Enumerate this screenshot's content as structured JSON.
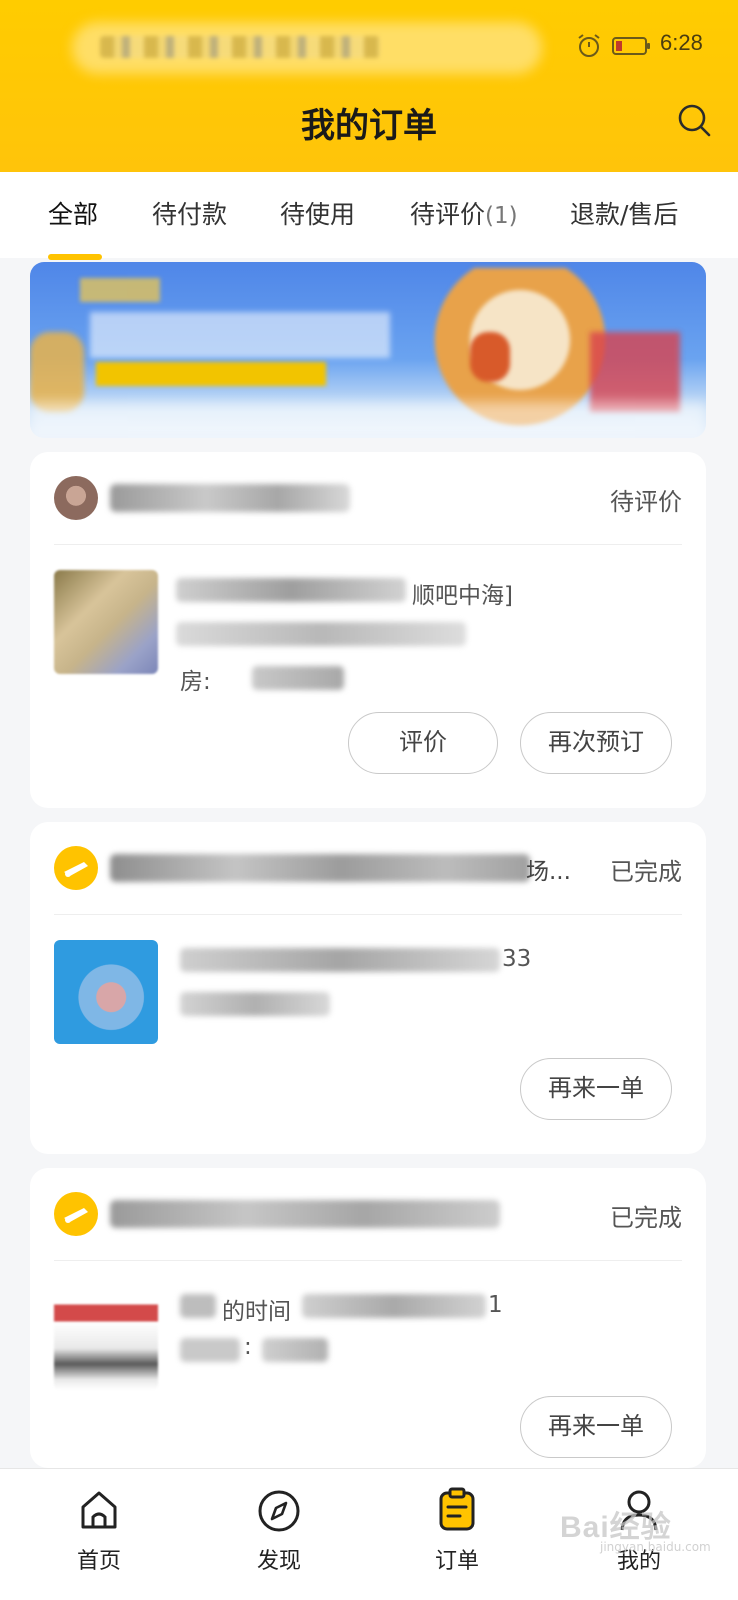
{
  "status_bar": {
    "time": "6:28"
  },
  "header": {
    "title": "我的订单"
  },
  "tabs": [
    {
      "label": "全部",
      "count": ""
    },
    {
      "label": "待付款",
      "count": ""
    },
    {
      "label": "待使用",
      "count": ""
    },
    {
      "label": "待评价",
      "count": "(1)"
    },
    {
      "label": "退款/售后",
      "count": ""
    }
  ],
  "orders": [
    {
      "status": "待评价",
      "title_fragment": "顺吧中海]",
      "detail_fragment": "房:",
      "buttons": [
        "评价",
        "再次预订"
      ]
    },
    {
      "status": "已完成",
      "shop_suffix": "场...",
      "detail_fragment": "33",
      "buttons": [
        "再来一单"
      ]
    },
    {
      "status": "已完成",
      "detail_prefix": "的时间",
      "detail_fragment": "1",
      "qty_fragment": ":",
      "buttons": [
        "再来一单"
      ]
    }
  ],
  "bottom_nav": [
    {
      "label": "首页",
      "icon": "home-icon"
    },
    {
      "label": "发现",
      "icon": "compass-icon"
    },
    {
      "label": "订单",
      "icon": "order-list-icon"
    },
    {
      "label": "我的",
      "icon": "profile-icon"
    }
  ],
  "watermark": {
    "text": "Bai经验",
    "sub": "jingyan.baidu.com"
  },
  "colors": {
    "brand_yellow": "#ffc300",
    "text": "#222222",
    "muted": "#555555"
  }
}
